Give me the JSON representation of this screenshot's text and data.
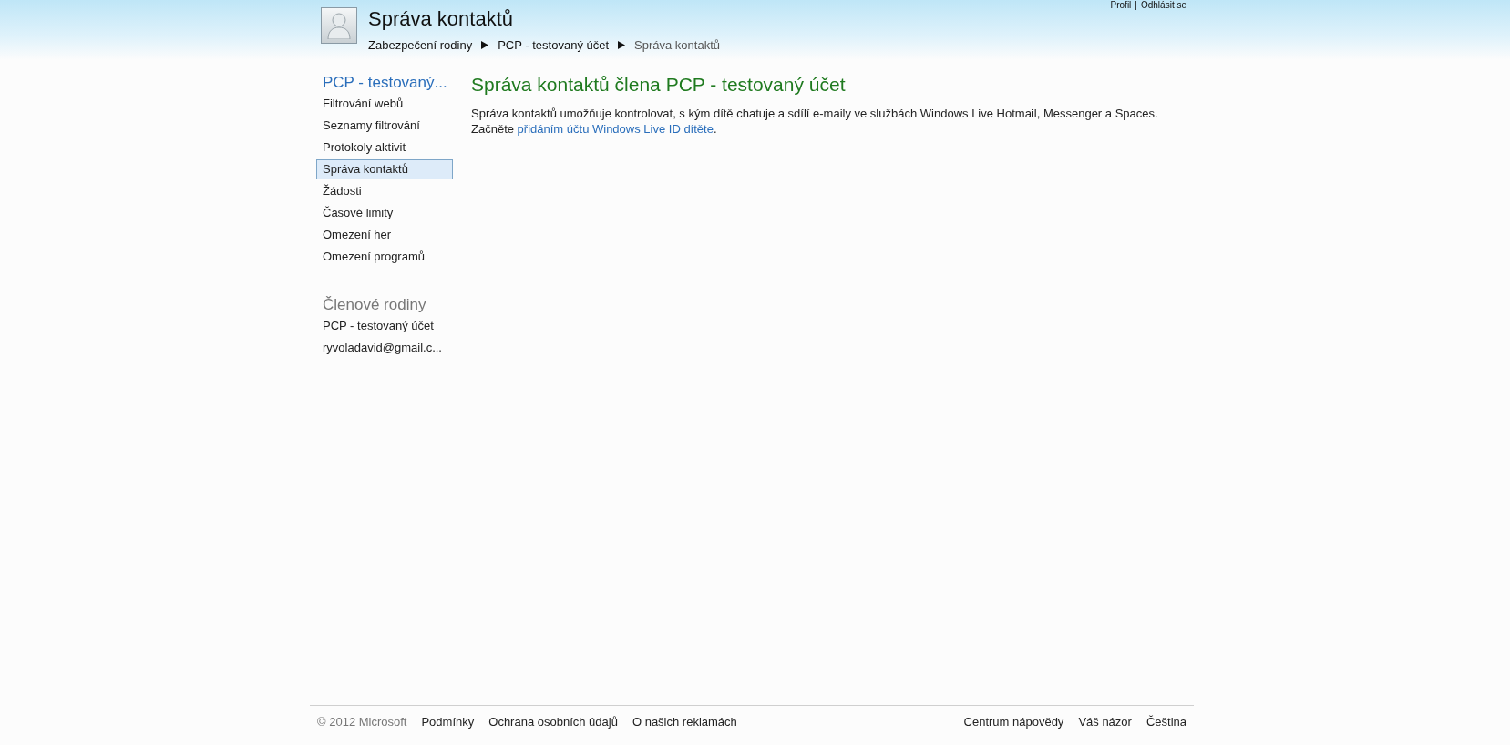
{
  "header": {
    "title": "Správa kontaktů",
    "account_separator": "|",
    "account_links": [
      {
        "label": "Profil"
      },
      {
        "label": "Odhlásit se"
      }
    ],
    "breadcrumb": [
      {
        "label": "Zabezpečení rodiny",
        "current": false
      },
      {
        "label": "PCP - testovaný účet",
        "current": false
      },
      {
        "label": "Správa kontaktů",
        "current": true
      }
    ]
  },
  "sidebar": {
    "title": "PCP - testovaný...",
    "items": [
      {
        "label": "Filtrování webů",
        "selected": false
      },
      {
        "label": "Seznamy filtrování",
        "selected": false
      },
      {
        "label": "Protokoly aktivit",
        "selected": false
      },
      {
        "label": "Správa kontaktů",
        "selected": true
      },
      {
        "label": "Žádosti",
        "selected": false
      },
      {
        "label": "Časové limity",
        "selected": false
      },
      {
        "label": "Omezení her",
        "selected": false
      },
      {
        "label": "Omezení programů",
        "selected": false
      }
    ],
    "members_title": "Členové rodiny",
    "members": [
      {
        "label": "PCP - testovaný účet"
      },
      {
        "label": "ryvoladavid@gmail.c..."
      }
    ]
  },
  "main": {
    "heading": "Správa kontaktů člena PCP - testovaný účet",
    "description": "Správa kontaktů umožňuje kontrolovat, s kým dítě chatuje a sdílí e-maily ve službách Windows Live Hotmail, Messenger a Spaces.",
    "prompt": "Začněte ",
    "link": "přidáním účtu Windows Live ID dítěte",
    "prompt_end": "."
  },
  "footer": {
    "copyright": "© 2012 Microsoft",
    "left_links": [
      {
        "label": "Podmínky"
      },
      {
        "label": "Ochrana osobních údajů"
      },
      {
        "label": "O našich reklamách"
      }
    ],
    "right_links": [
      {
        "label": "Centrum nápovědy"
      },
      {
        "label": "Váš názor"
      },
      {
        "label": "Čeština"
      }
    ]
  }
}
